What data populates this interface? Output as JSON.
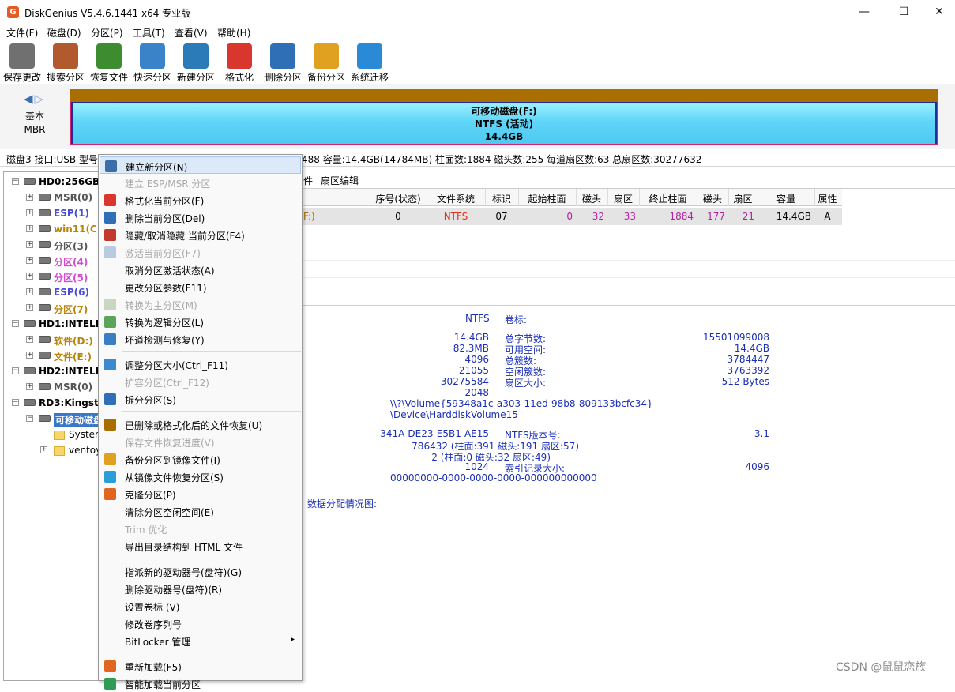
{
  "window": {
    "title": "DiskGenius V5.4.6.1441 x64 专业版",
    "app_icon_letter": "G",
    "minimize": "—",
    "maximize": "☐",
    "close": "✕"
  },
  "menus": [
    "文件(F)",
    "磁盘(D)",
    "分区(P)",
    "工具(T)",
    "查看(V)",
    "帮助(H)"
  ],
  "toolbar": [
    {
      "label": "保存更改",
      "icon": "save-icon",
      "color": "#707070"
    },
    {
      "label": "搜索分区",
      "icon": "search-icon",
      "color": "#b05a2e"
    },
    {
      "label": "恢复文件",
      "icon": "recover-icon",
      "color": "#3d8c2f"
    },
    {
      "label": "快速分区",
      "icon": "quick-partition-icon",
      "color": "#3b83c8"
    },
    {
      "label": "新建分区",
      "icon": "new-partition-icon",
      "color": "#2b7bb9"
    },
    {
      "label": "格式化",
      "icon": "format-icon",
      "color": "#d9372e"
    },
    {
      "label": "删除分区",
      "icon": "delete-icon",
      "color": "#2f6fb5"
    },
    {
      "label": "备份分区",
      "icon": "backup-icon",
      "color": "#e0a020"
    },
    {
      "label": "系统迁移",
      "icon": "migrate-icon",
      "color": "#2a8ad6"
    }
  ],
  "disk_map": {
    "type_line1": "基本",
    "type_line2": "MBR",
    "partition_line1": "可移动磁盘(F:)",
    "partition_line2": "NTFS (活动)",
    "partition_line3": "14.4GB"
  },
  "info_bar": "磁盘3 接口:USB  型号",
  "info_bar_rest": "488  容量:14.4GB(14784MB)  柱面数:1884  磁头数:255  每道扇区数:63  总扇区数:30277632",
  "tree": [
    {
      "label": "HD0:256GBS",
      "level": 0,
      "color": "#000"
    },
    {
      "label": "MSR(0)",
      "level": 1,
      "color": "#555"
    },
    {
      "label": "ESP(1)",
      "level": 1,
      "color": "#4b4bd6"
    },
    {
      "label": "win11(C:)",
      "level": 1,
      "color": "#b8860b"
    },
    {
      "label": "分区(3)",
      "level": 1,
      "color": "#555"
    },
    {
      "label": "分区(4)",
      "level": 1,
      "color": "#d24bd2"
    },
    {
      "label": "分区(5)",
      "level": 1,
      "color": "#d24bd2"
    },
    {
      "label": "ESP(6)",
      "level": 1,
      "color": "#4b4bd6"
    },
    {
      "label": "分区(7)",
      "level": 1,
      "color": "#b8860b"
    },
    {
      "label": "HD1:INTELH",
      "level": 0,
      "color": "#000"
    },
    {
      "label": "软件(D:)",
      "level": 1,
      "color": "#b8860b"
    },
    {
      "label": "文件(E:)",
      "level": 1,
      "color": "#b8860b"
    },
    {
      "label": "HD2:INTELH",
      "level": 0,
      "color": "#000"
    },
    {
      "label": "MSR(0)",
      "level": 1,
      "color": "#555"
    },
    {
      "label": "RD3:Kingsto",
      "level": 0,
      "color": "#000"
    },
    {
      "label": "可移动磁盘",
      "level": 1,
      "color": "#fff",
      "selected": true
    },
    {
      "label": "System",
      "level": 2,
      "color": "#000"
    },
    {
      "label": "ventoy",
      "level": 2,
      "color": "#000"
    }
  ],
  "tabs": [
    "件",
    "扇区编辑"
  ],
  "grid": {
    "headers": [
      "序号(状态)",
      "文件系统",
      "标识",
      "起始柱面",
      "磁头",
      "扇区",
      "终止柱面",
      "磁头",
      "扇区",
      "容量",
      "属性"
    ],
    "row": {
      "name": "F:)",
      "index": "0",
      "fs": "NTFS",
      "id": "07",
      "start_cyl": "0",
      "start_head": "32",
      "start_sec": "33",
      "end_cyl": "1884",
      "end_head": "177",
      "end_sec": "21",
      "capacity": "14.4GB",
      "attr": "A"
    }
  },
  "details": {
    "fs": "NTFS",
    "volume_label_key": "卷标:",
    "total_capacity": "14.4GB",
    "total_bytes_key": "总字节数:",
    "total_bytes": "15501099008",
    "free_space": "82.3MB",
    "free_key": "可用空间:",
    "free_value": "14.4GB",
    "cluster_size": "4096",
    "total_clusters_key": "总簇数:",
    "total_clusters": "3784447",
    "used_clusters": "21055",
    "free_clusters_key": "空闲簇数:",
    "free_clusters": "3763392",
    "total_sectors": "30275584",
    "sector_size_key": "扇区大小:",
    "sector_size": "512 Bytes",
    "start_sector": "2048",
    "volume_guid": "\\\\?\\Volume{59348a1c-a303-11ed-98b8-809133bcfc34}",
    "device_path": "\\Device\\HarddiskVolume15",
    "serial": "341A-DE23-E5B1-AE15",
    "ntfs_ver_key": "NTFS版本号:",
    "ntfs_ver": "3.1",
    "mft_cluster": "786432 (柱面:391 磁头:191 扇区:57)",
    "mft_mirror": "2 (柱面:0 磁头:32 扇区:49)",
    "record_size": "1024",
    "index_size_key": "索引记录大小:",
    "index_size": "4096",
    "guid": "00000000-0000-0000-0000-000000000000",
    "alloc_label": "数据分配情况图:"
  },
  "context_menu": [
    {
      "label": "建立新分区(N)",
      "disabled": false,
      "highlight": true,
      "icon": "new-partition-icon",
      "color": "#3b6ea8"
    },
    {
      "label": "建立 ESP/MSR 分区",
      "disabled": true,
      "icon": "",
      "color": ""
    },
    {
      "label": "格式化当前分区(F)",
      "disabled": false,
      "icon": "format-icon",
      "color": "#d9372e"
    },
    {
      "label": "删除当前分区(Del)",
      "disabled": false,
      "icon": "delete-icon",
      "color": "#2f6fb5"
    },
    {
      "label": "隐藏/取消隐藏 当前分区(F4)",
      "disabled": false,
      "icon": "hide-icon",
      "color": "#c0392b"
    },
    {
      "label": "激活当前分区(F7)",
      "disabled": true,
      "icon": "activate-icon",
      "color": "#b9cbe0"
    },
    {
      "label": "取消分区激活状态(A)",
      "disabled": false,
      "icon": "",
      "color": ""
    },
    {
      "label": "更改分区参数(F11)",
      "disabled": false,
      "icon": "",
      "color": ""
    },
    {
      "label": "转换为主分区(M)",
      "disabled": true,
      "icon": "convert-primary-icon",
      "color": "#c9d6c0"
    },
    {
      "label": "转换为逻辑分区(L)",
      "disabled": false,
      "icon": "convert-logical-icon",
      "color": "#5aa55a"
    },
    {
      "label": "坏道检测与修复(Y)",
      "disabled": false,
      "icon": "repair-icon",
      "color": "#3a7fc2"
    },
    {
      "sep": true
    },
    {
      "label": "调整分区大小(Ctrl_F11)",
      "disabled": false,
      "icon": "resize-icon",
      "color": "#3a8ad0"
    },
    {
      "label": "扩容分区(Ctrl_F12)",
      "disabled": true,
      "icon": "",
      "color": ""
    },
    {
      "label": "拆分分区(S)",
      "disabled": false,
      "icon": "split-icon",
      "color": "#2f6fb5"
    },
    {
      "sep": true
    },
    {
      "label": "已删除或格式化后的文件恢复(U)",
      "disabled": false,
      "icon": "recover-icon",
      "color": "#a86f00"
    },
    {
      "label": "保存文件恢复进度(V)",
      "disabled": true,
      "icon": "",
      "color": ""
    },
    {
      "label": "备份分区到镜像文件(I)",
      "disabled": false,
      "icon": "backup-icon",
      "color": "#e0a020"
    },
    {
      "label": "从镜像文件恢复分区(S)",
      "disabled": false,
      "icon": "restore-image-icon",
      "color": "#2a9fd6"
    },
    {
      "label": "克隆分区(P)",
      "disabled": false,
      "icon": "clone-icon",
      "color": "#e0661f"
    },
    {
      "label": "清除分区空闲空间(E)",
      "disabled": false,
      "icon": "",
      "color": ""
    },
    {
      "label": "Trim 优化",
      "disabled": true,
      "icon": "",
      "color": ""
    },
    {
      "label": "导出目录结构到 HTML 文件",
      "disabled": false,
      "icon": "",
      "color": ""
    },
    {
      "sep": true
    },
    {
      "label": "指派新的驱动器号(盘符)(G)",
      "disabled": false,
      "icon": "",
      "color": ""
    },
    {
      "label": "删除驱动器号(盘符)(R)",
      "disabled": false,
      "icon": "",
      "color": ""
    },
    {
      "label": "设置卷标 (V)",
      "disabled": false,
      "icon": "",
      "color": ""
    },
    {
      "label": "修改卷序列号",
      "disabled": false,
      "icon": "",
      "color": ""
    },
    {
      "label": "BitLocker 管理",
      "disabled": false,
      "icon": "",
      "color": "",
      "submenu": true
    },
    {
      "sep": true
    },
    {
      "label": "重新加载(F5)",
      "disabled": false,
      "icon": "reload-icon",
      "color": "#e0661f"
    },
    {
      "label": "智能加载当前分区",
      "disabled": false,
      "icon": "smart-load-icon",
      "color": "#2f9c55"
    }
  ],
  "submenu_arrow": "▸",
  "watermark": "CSDN @鼠鼠恋族"
}
